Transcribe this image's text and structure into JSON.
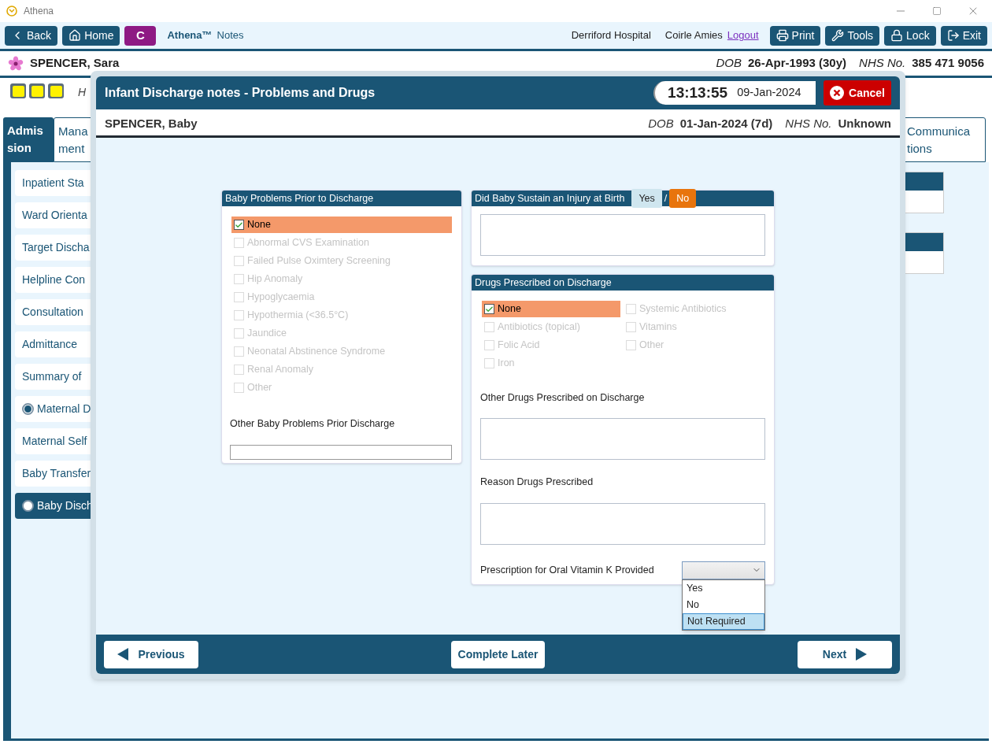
{
  "window": {
    "title": "Athena"
  },
  "toolbar": {
    "left_buttons": [
      {
        "label": "Back",
        "kind": "back"
      },
      {
        "label": "Home",
        "kind": "home"
      }
    ],
    "badge": "C",
    "app_name": "Athena™",
    "app_suffix": "Notes",
    "hospital": "Derriford Hospital",
    "user": "Coirle Amies",
    "logout": "Logout",
    "right_buttons": [
      {
        "label": "Print",
        "kind": "print"
      },
      {
        "label": "Tools",
        "kind": "tools"
      },
      {
        "label": "Lock",
        "kind": "lock"
      },
      {
        "label": "Exit",
        "kind": "exit"
      }
    ]
  },
  "patient": {
    "name": "SPENCER, Sara",
    "dob_label": "DOB",
    "dob": "26-Apr-1993 (30y)",
    "nhs_label": "NHS No.",
    "nhs": "385 471 9056"
  },
  "info_row": {
    "text": "H"
  },
  "tabs": [
    {
      "lines": [
        "Admis",
        "sion"
      ],
      "selected": true
    },
    {
      "lines": [
        "Mana",
        "ment"
      ],
      "selected": false
    },
    {
      "lines": [
        "Communica",
        "tions"
      ],
      "selected": false
    }
  ],
  "sidebar": {
    "items": [
      {
        "label": "Inpatient Sta",
        "kind": "plain",
        "selected": false
      },
      {
        "label": "Ward Orienta",
        "kind": "plain",
        "selected": false
      },
      {
        "label": "Target Discha",
        "kind": "plain",
        "selected": false
      },
      {
        "label": "Helpline Con",
        "kind": "plain",
        "selected": false
      },
      {
        "label": "Consultation",
        "kind": "plain",
        "selected": false
      },
      {
        "label": "Admittance",
        "kind": "plain",
        "selected": false
      },
      {
        "label": "Summary of",
        "kind": "plain",
        "selected": false
      },
      {
        "label": "Maternal D",
        "kind": "radio",
        "checked": true,
        "selected": false
      },
      {
        "label": "Maternal Self",
        "kind": "plain",
        "selected": false
      },
      {
        "label": "Baby Transfer",
        "kind": "plain",
        "selected": false
      },
      {
        "label": "Baby Disch",
        "kind": "radio",
        "checked": false,
        "selected": true
      }
    ]
  },
  "modal": {
    "title": "Infant Discharge notes - Problems and Drugs",
    "time": "13:13:55",
    "date": "09-Jan-2024",
    "cancel": "Cancel",
    "baby": {
      "name": "SPENCER, Baby",
      "dob_label": "DOB",
      "dob": "01-Jan-2024 (7d)",
      "nhs_label": "NHS No.",
      "nhs": "Unknown"
    },
    "problems": {
      "title": "Baby Problems Prior to Discharge",
      "options": [
        {
          "label": "None",
          "checked": true,
          "disabled": false
        },
        {
          "label": "Abnormal CVS Examination",
          "checked": false,
          "disabled": true
        },
        {
          "label": "Failed Pulse Oximtery Screening",
          "checked": false,
          "disabled": true
        },
        {
          "label": "Hip Anomaly",
          "checked": false,
          "disabled": true
        },
        {
          "label": "Hypoglycaemia",
          "checked": false,
          "disabled": true
        },
        {
          "label": "Hypothermia (<36.5°C)",
          "checked": false,
          "disabled": true
        },
        {
          "label": "Jaundice",
          "checked": false,
          "disabled": true
        },
        {
          "label": "Neonatal Abstinence Syndrome",
          "checked": false,
          "disabled": true
        },
        {
          "label": "Renal Anomaly",
          "checked": false,
          "disabled": true
        },
        {
          "label": "Other",
          "checked": false,
          "disabled": true
        }
      ],
      "other_label": "Other Baby Problems Prior Discharge"
    },
    "injury": {
      "title": "Did Baby Sustain an Injury at Birth",
      "choices": [
        {
          "label": "Yes",
          "selected": false
        },
        {
          "label": "No",
          "selected": true
        }
      ],
      "separator": "/"
    },
    "drugs": {
      "title": "Drugs Prescribed on Discharge",
      "options": [
        {
          "label": "None",
          "checked": true,
          "disabled": false
        },
        {
          "label": "Antibiotics (topical)",
          "checked": false,
          "disabled": true
        },
        {
          "label": "Folic Acid",
          "checked": false,
          "disabled": true
        },
        {
          "label": "Iron",
          "checked": false,
          "disabled": true
        },
        {
          "label": "Systemic Antibiotics",
          "checked": false,
          "disabled": true
        },
        {
          "label": "Vitamins",
          "checked": false,
          "disabled": true
        },
        {
          "label": "Other",
          "checked": false,
          "disabled": true
        }
      ],
      "other_label": "Other Drugs Prescribed on Discharge",
      "reason_label": "Reason Drugs Prescribed",
      "vitk": {
        "label": "Prescription for Oral Vitamin K Provided",
        "expanded": true,
        "options": [
          {
            "label": "Yes",
            "selected": false
          },
          {
            "label": "No",
            "selected": false
          },
          {
            "label": "Not Required",
            "selected": true
          }
        ]
      }
    },
    "footer": {
      "previous": "Previous",
      "complete_later": "Complete Later",
      "next": "Next"
    }
  }
}
